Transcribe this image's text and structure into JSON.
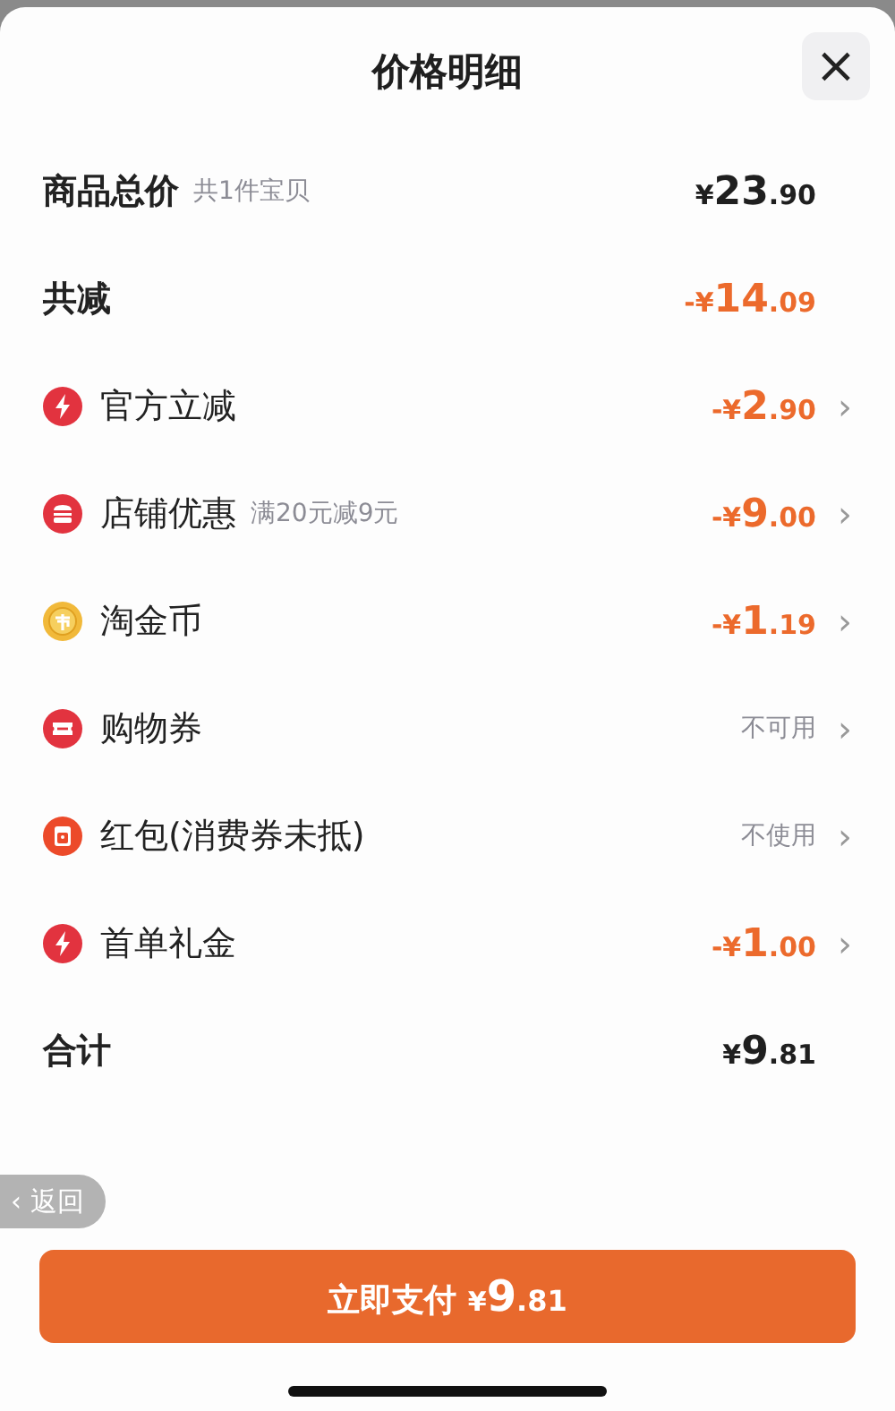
{
  "sheet": {
    "title": "价格明细",
    "close": "×"
  },
  "rows": [
    {
      "kind": "summary",
      "label": "商品总价",
      "note": "共1件宝贝",
      "amount": {
        "prefix": "¥",
        "whole": "23",
        "fraction": ".90",
        "color": "#1f1f1f"
      }
    },
    {
      "kind": "summary",
      "label": "共减",
      "amount": {
        "prefix": "-¥",
        "whole": "14",
        "fraction": ".09",
        "color": "#ec6a2c"
      }
    },
    {
      "kind": "discount",
      "label": "官方立减",
      "amount": {
        "prefix": "-¥",
        "whole": "2",
        "fraction": ".90",
        "color": "#ec6a2c"
      },
      "chevron": "›"
    },
    {
      "kind": "discount",
      "label": "店铺优惠",
      "note": "满20元减9元",
      "amount": {
        "prefix": "-¥",
        "whole": "9",
        "fraction": ".00",
        "color": "#ec6a2c"
      },
      "chevron": "›"
    },
    {
      "kind": "discount",
      "label": "淘金币",
      "amount": {
        "prefix": "-¥",
        "whole": "1",
        "fraction": ".19",
        "color": "#ec6a2c"
      },
      "chevron": "›"
    },
    {
      "kind": "discount",
      "label": "购物券",
      "status": "不可用",
      "chevron": "›"
    },
    {
      "kind": "discount",
      "label": "红包(消费券未抵)",
      "status": "不使用",
      "chevron": "›"
    },
    {
      "kind": "discount",
      "label": "首单礼金",
      "amount": {
        "prefix": "-¥",
        "whole": "1",
        "fraction": ".00",
        "color": "#ec6a2c"
      },
      "chevron": "›"
    },
    {
      "kind": "summary",
      "label": "合计",
      "amount": {
        "prefix": "¥",
        "whole": "9",
        "fraction": ".81",
        "color": "#1f1f1f"
      }
    }
  ],
  "back": {
    "chevron": "‹",
    "label": "返回"
  },
  "pay": {
    "label": "立即支付",
    "prefix": "¥",
    "whole": "9",
    "fraction": ".81"
  }
}
